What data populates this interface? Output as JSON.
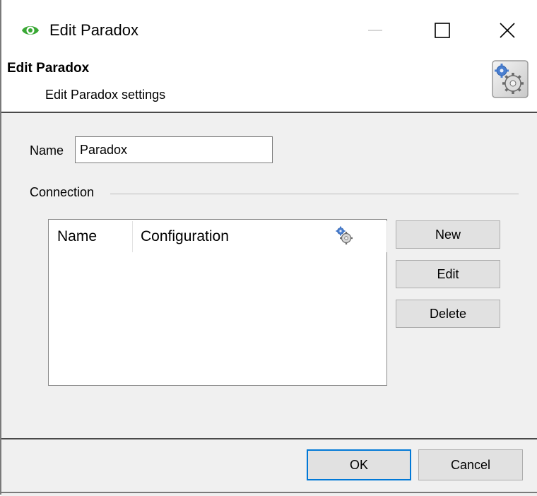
{
  "window": {
    "title": "Edit Paradox",
    "icon": "eye-icon",
    "controls": [
      "minimize-icon",
      "maximize-icon",
      "close-icon"
    ]
  },
  "header": {
    "title": "Edit Paradox",
    "subtitle": "Edit Paradox settings",
    "icon": "settings-gears-icon"
  },
  "form": {
    "name_label": "Name",
    "name_value": "Paradox",
    "connection_label": "Connection"
  },
  "connection_table": {
    "columns": [
      "Name",
      "Configuration"
    ],
    "settings_icon": "gears-icon",
    "rows": []
  },
  "side_buttons": {
    "new_label": "New",
    "edit_label": "Edit",
    "delete_label": "Delete"
  },
  "footer": {
    "ok_label": "OK",
    "cancel_label": "Cancel"
  },
  "colors": {
    "accent": "#0078d7",
    "app_icon_green": "#3aa835",
    "gear_blue": "#4a7fd0"
  }
}
